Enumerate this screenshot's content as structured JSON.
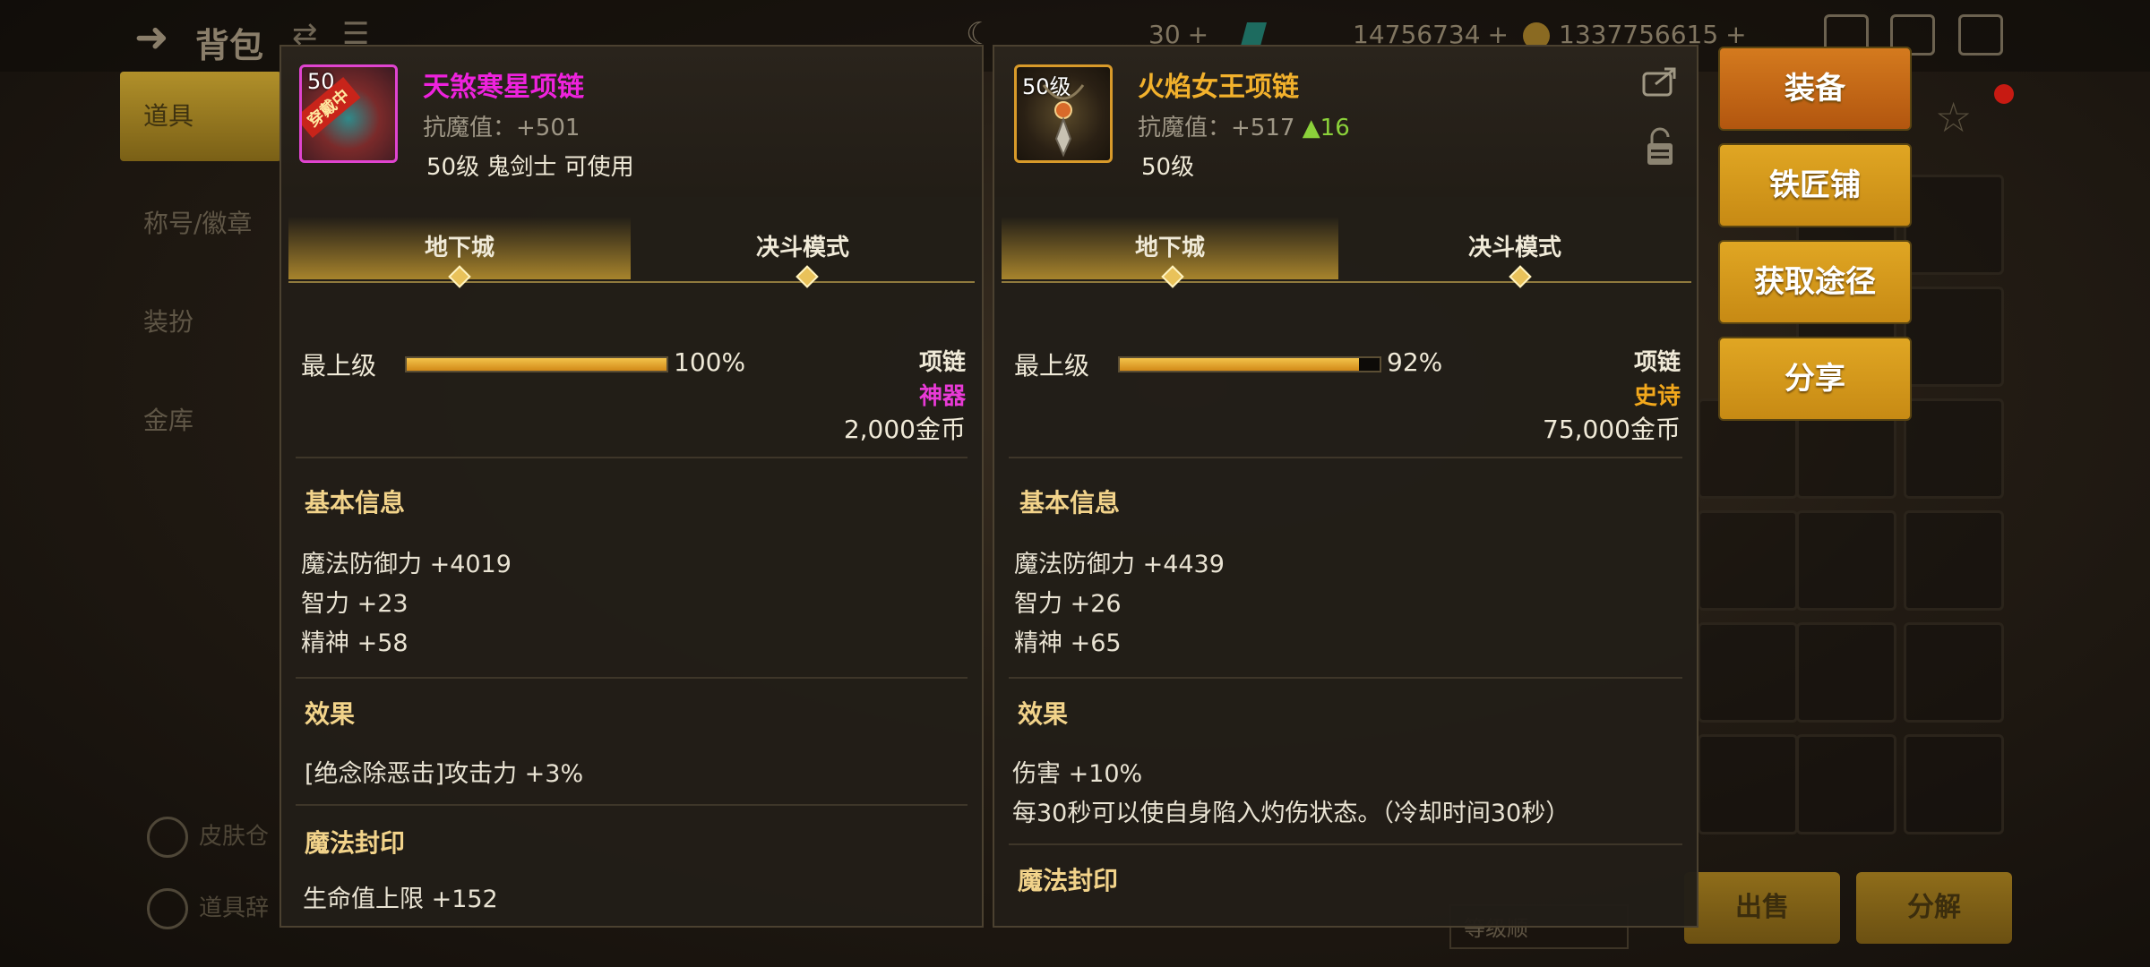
{
  "background": {
    "title": "背包",
    "resources": [
      "30",
      "14756734",
      "1337756615"
    ],
    "side_menu": [
      "道具",
      "称号/徽章",
      "装扮",
      "金库"
    ],
    "side_footer": [
      "皮肤仓",
      "道具辞"
    ],
    "bottom_buttons": [
      "出售",
      "分解"
    ],
    "sort_label": "等级顺"
  },
  "left_panel": {
    "level_badge": "50",
    "wearing_badge": "穿戴中",
    "name": "天煞寒星项链",
    "name_color": "#ee22dd",
    "antimagic": "抗魔值：+501",
    "requirement": "50级 鬼剑士 可使用",
    "tabs": [
      "地下城",
      "决斗模式"
    ],
    "grade_label": "最上级",
    "grade_percent": 100,
    "grade_text": "100%",
    "item_type": "项链",
    "rarity": "神器",
    "rarity_color": "#e83ad6",
    "price": "2,000金币",
    "basic_title": "基本信息",
    "basic_stats": [
      "魔法防御力 +4019",
      "智力 +23",
      "精神 +58"
    ],
    "effect_title": "效果",
    "effects": [
      "[绝念除恶击]攻击力 +3%"
    ],
    "seal_title": "魔法封印",
    "seal_stats": [
      "生命值上限 +152"
    ]
  },
  "right_panel": {
    "level_badge": "50级",
    "name": "火焰女王项链",
    "name_color": "#f2b12c",
    "antimagic": "抗魔值：+517",
    "antimagic_delta": "▲16",
    "requirement": "50级",
    "tabs": [
      "地下城",
      "决斗模式"
    ],
    "grade_label": "最上级",
    "grade_percent": 92,
    "grade_text": "92%",
    "item_type": "项链",
    "rarity": "史诗",
    "rarity_color": "#f2a81c",
    "price": "75,000金币",
    "basic_title": "基本信息",
    "basic_stats": [
      "魔法防御力 +4439",
      "智力 +26",
      "精神 +65"
    ],
    "effect_title": "效果",
    "effects": [
      "伤害 +10%",
      "每30秒可以使自身陷入灼伤状态。（冷却时间30秒）"
    ],
    "seal_title": "魔法封印"
  },
  "actions": {
    "equip": "装备",
    "smith": "铁匠铺",
    "obtain": "获取途径",
    "share": "分享"
  },
  "icons": {
    "share": "share-icon",
    "lock": "lock-icon"
  }
}
